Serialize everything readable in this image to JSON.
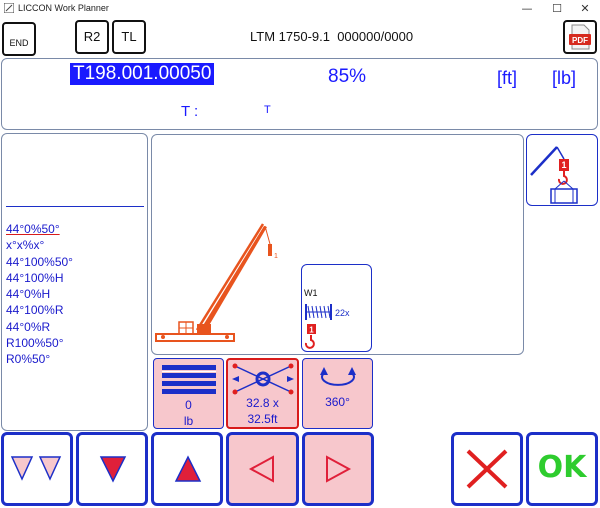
{
  "window": {
    "title": "LICCON Work Planner",
    "minimize": "—",
    "maximize": "☐",
    "close": "✕"
  },
  "toolbar": {
    "end_label": "END",
    "r2_label": "R2",
    "tl_label": "TL",
    "crane_model": "LTM 1750-9.1",
    "code": "000000/0000",
    "pdf_label": "PDF"
  },
  "info": {
    "table_code": "T198.001.00050",
    "percent": "85%",
    "unit_length": "[ft]",
    "unit_weight": "[lb]",
    "t_label": "T :",
    "t_value": "T"
  },
  "configs": [
    "44°0%50°",
    "x°x%x°",
    "44°100%50°",
    "44°100%H",
    "44°0%H",
    "44°100%R",
    "44°0%R",
    "R100%50°",
    "R0%50°"
  ],
  "diagram": {
    "hook_label": "1",
    "winch_label": "W1",
    "reeving": "22x",
    "winch_hook": "1"
  },
  "params": {
    "counterweight_value": "0",
    "counterweight_unit": "lb",
    "outrigger_line1": "32.8 x",
    "outrigger_line2": "32.5ft",
    "slewing": "360°"
  },
  "actions": {
    "ok_label": "OK"
  },
  "colors": {
    "accent_blue": "#1c2fc8",
    "text_blue": "#1a1aff",
    "crane_orange": "#e8541e",
    "pink": "#f7c7cc",
    "ok_green": "#2ecc2e",
    "cancel_red": "#e02020"
  }
}
